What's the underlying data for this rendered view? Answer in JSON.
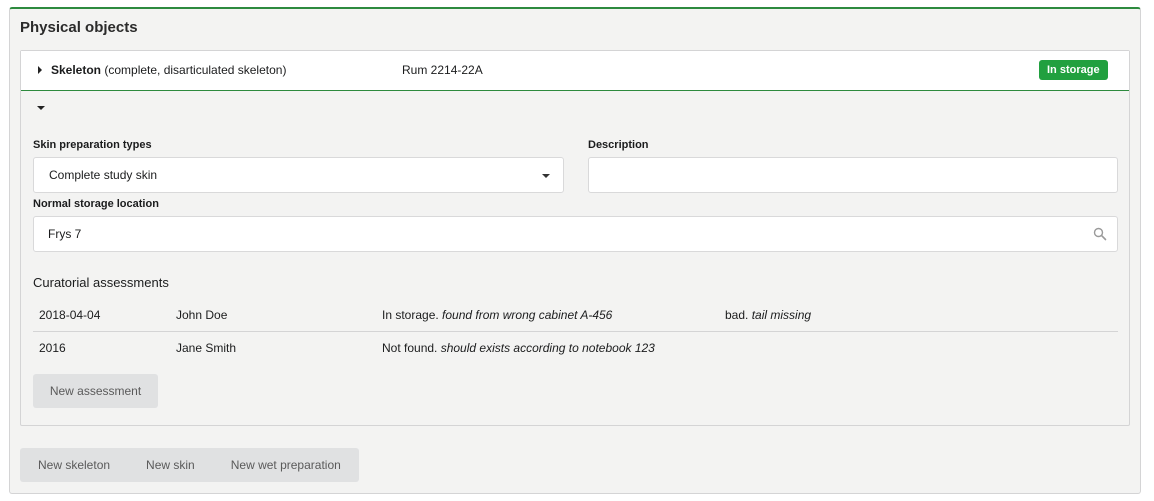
{
  "panel": {
    "title": "Physical objects"
  },
  "object": {
    "type_label": "Skeleton",
    "type_detail": " (complete, disarticulated skeleton)",
    "location": "Rum 2214-22A",
    "status": "In storage",
    "status_color": "#21a03f"
  },
  "form": {
    "prep_types_label": "Skin preparation types",
    "prep_types_value": "Complete study skin",
    "description_label": "Description",
    "description_value": "",
    "storage_label": "Normal storage location",
    "storage_value": "Frys 7"
  },
  "assessments": {
    "title": "Curatorial assessments",
    "rows": [
      {
        "date": "2018-04-04",
        "agent": "John Doe",
        "status": "In storage.",
        "status_note": " found from wrong cabinet A-456",
        "condition": "bad.",
        "condition_note": " tail missing"
      },
      {
        "date": "2016",
        "agent": "Jane Smith",
        "status": "Not found.",
        "status_note": " should exists according to notebook 123",
        "condition": "",
        "condition_note": ""
      }
    ],
    "new_button": "New assessment"
  },
  "actions": {
    "new_skeleton": "New skeleton",
    "new_skin": "New skin",
    "new_wet_preparation": "New wet preparation"
  },
  "icons": {
    "expand": "caret-right-icon",
    "collapse": "caret-down-icon",
    "dropdown": "chevron-down-icon",
    "search": "search-icon"
  },
  "colors": {
    "accent_green": "#2d8a3e",
    "badge_green": "#21a03f",
    "button_gray": "#e0e1e2"
  }
}
